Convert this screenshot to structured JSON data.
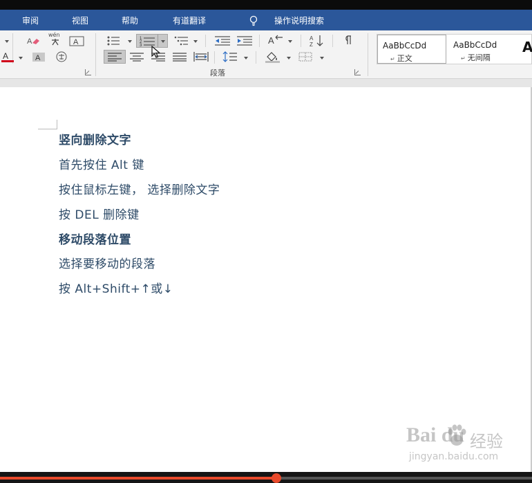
{
  "menu": {
    "items": [
      "审阅",
      "视图",
      "帮助",
      "有道翻译",
      "操作说明搜索"
    ]
  },
  "ribbon": {
    "paragraph_group_label": "段落",
    "phonetic_guide_label": "wén",
    "styles": [
      {
        "sample": "AaBbCcDd",
        "name": "正文"
      },
      {
        "sample": "AaBbCcDd",
        "name": "无间隔"
      }
    ],
    "next_style_partial": "A"
  },
  "document": {
    "lines": [
      {
        "text": "竖向删除文字",
        "bold": true
      },
      {
        "text": "首先按住 Alt 键",
        "bold": false
      },
      {
        "text": "按住鼠标左键， 选择删除文字",
        "bold": false
      },
      {
        "text": "按 DEL 删除键",
        "bold": false
      },
      {
        "text": "移动段落位置",
        "bold": true
      },
      {
        "text": "选择要移动的段落",
        "bold": false
      },
      {
        "text": "按 Alt+Shift+↑或↓",
        "bold": false
      }
    ]
  },
  "watermark": {
    "logo": "Bai du",
    "name": "经验",
    "url": "jingyan.baidu.com"
  },
  "video": {
    "progress_fraction": 0.52
  },
  "colors": {
    "menu_bar": "#2b579a",
    "doc_text": "#2e4b68",
    "progress": "#e8492b"
  },
  "icons": {
    "search_hint": "lightbulb-icon",
    "cursor": "mouse-pointer-icon"
  }
}
